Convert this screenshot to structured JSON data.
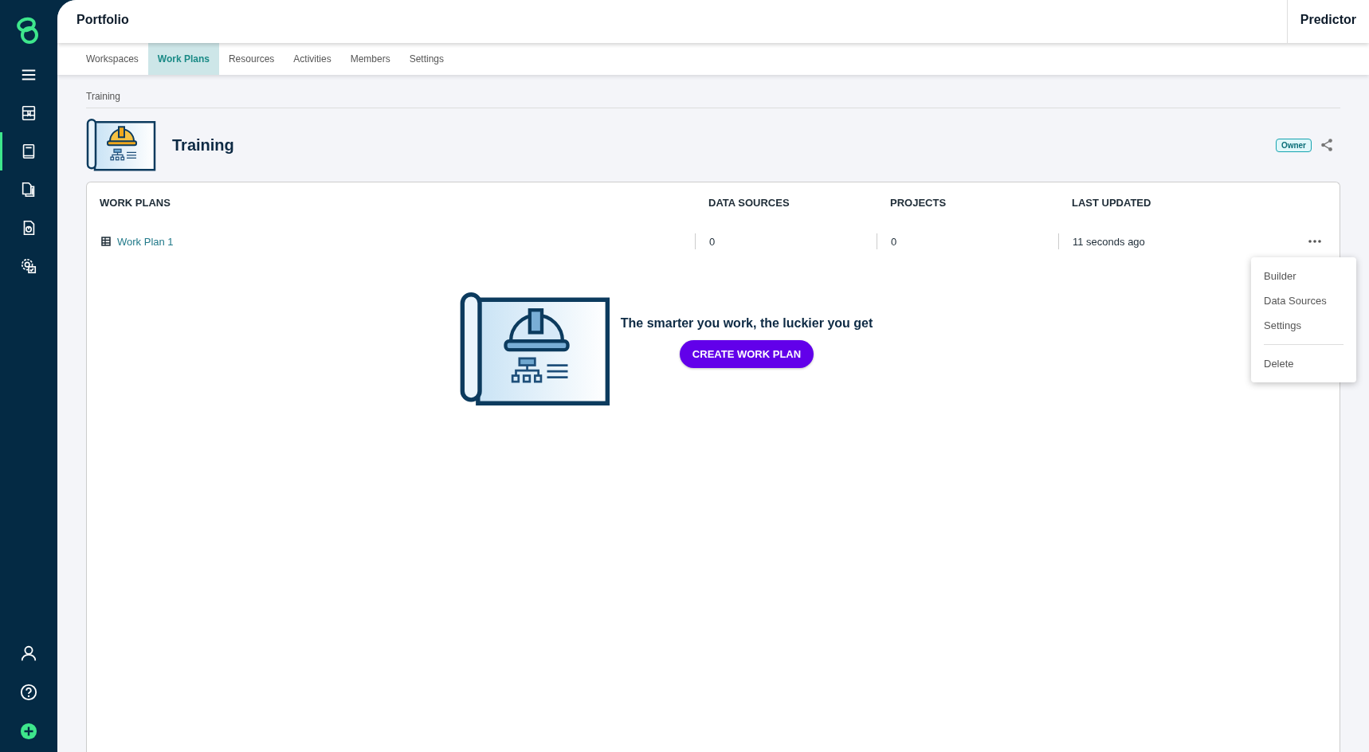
{
  "header": {
    "title": "Portfolio",
    "product": "Predictor"
  },
  "sidebar": {
    "items": [
      {
        "selected": false
      },
      {
        "selected": false
      },
      {
        "selected": true
      },
      {
        "selected": false
      },
      {
        "selected": false
      },
      {
        "selected": false
      }
    ]
  },
  "tabs": [
    {
      "label": "Workspaces",
      "selected": false
    },
    {
      "label": "Work Plans",
      "selected": true
    },
    {
      "label": "Resources",
      "selected": false
    },
    {
      "label": "Activities",
      "selected": false
    },
    {
      "label": "Members",
      "selected": false
    },
    {
      "label": "Settings",
      "selected": false
    }
  ],
  "breadcrumb": "Training",
  "page": {
    "title": "Training",
    "role_badge": "Owner"
  },
  "table": {
    "columns": [
      "WORK PLANS",
      "DATA SOURCES",
      "PROJECTS",
      "LAST UPDATED"
    ],
    "rows": [
      {
        "name": "Work Plan 1",
        "data_sources": "0",
        "projects": "0",
        "last_updated": "11 seconds ago"
      }
    ]
  },
  "row_menu": {
    "groups": [
      [
        "Builder",
        "Data Sources",
        "Settings"
      ],
      [
        "Delete"
      ]
    ]
  },
  "empty_state": {
    "message": "The smarter you work, the luckier you get",
    "button": "CREATE WORK PLAN"
  }
}
